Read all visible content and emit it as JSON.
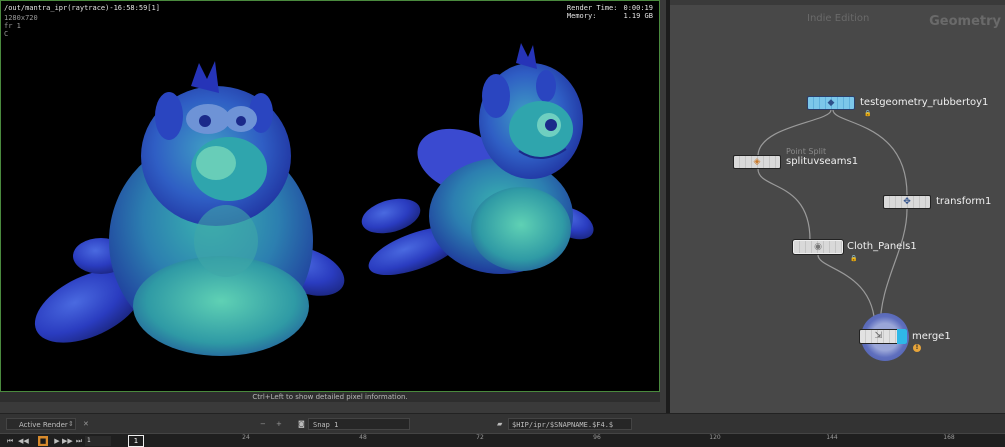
{
  "render_view": {
    "path": "/out/mantra_ipr(raytrace)-16:58:59[1]",
    "resolution": "1280x720",
    "frame": "fr 1",
    "channel": "C",
    "render_time_label": "Render Time:",
    "render_time": "0:00:19",
    "memory_label": "Memory:",
    "memory": "1.19 GB",
    "pixel_hint": "Ctrl+Left to show detailed pixel information."
  },
  "bottom_toolbar": {
    "active_render": "Active Render",
    "arrow": "⇕",
    "close": "✕",
    "zoom_minus": "−",
    "zoom_plus": "+",
    "snap": "Snap 1",
    "output_path": "$HIP/ipr/$SNAPNAME.$F4.$"
  },
  "timeline": {
    "buttons": [
      "⏮",
      "◀◀",
      "■",
      "▶",
      "▶▶",
      "⏭"
    ],
    "frame_field": "1",
    "current_frame": "1",
    "ticks": [
      "24",
      "48",
      "72",
      "96",
      "120",
      "144",
      "168"
    ]
  },
  "network": {
    "edition": "Indie Edition",
    "context": "Geometry",
    "nodes": {
      "testgeometry": "testgeometry_rubbertoy1",
      "splitseams_type": "Point Split",
      "splitseams": "splituvseams1",
      "transform": "transform1",
      "cloth_panels": "Cloth_Panels1",
      "merge": "merge1"
    }
  },
  "colors": {
    "render_border": "#4a8a3e",
    "play_button": "#d78a2c",
    "display_flag": "#2fb8e8",
    "merge_disc": "#5f6fbe",
    "warning": "#e8a53a"
  }
}
